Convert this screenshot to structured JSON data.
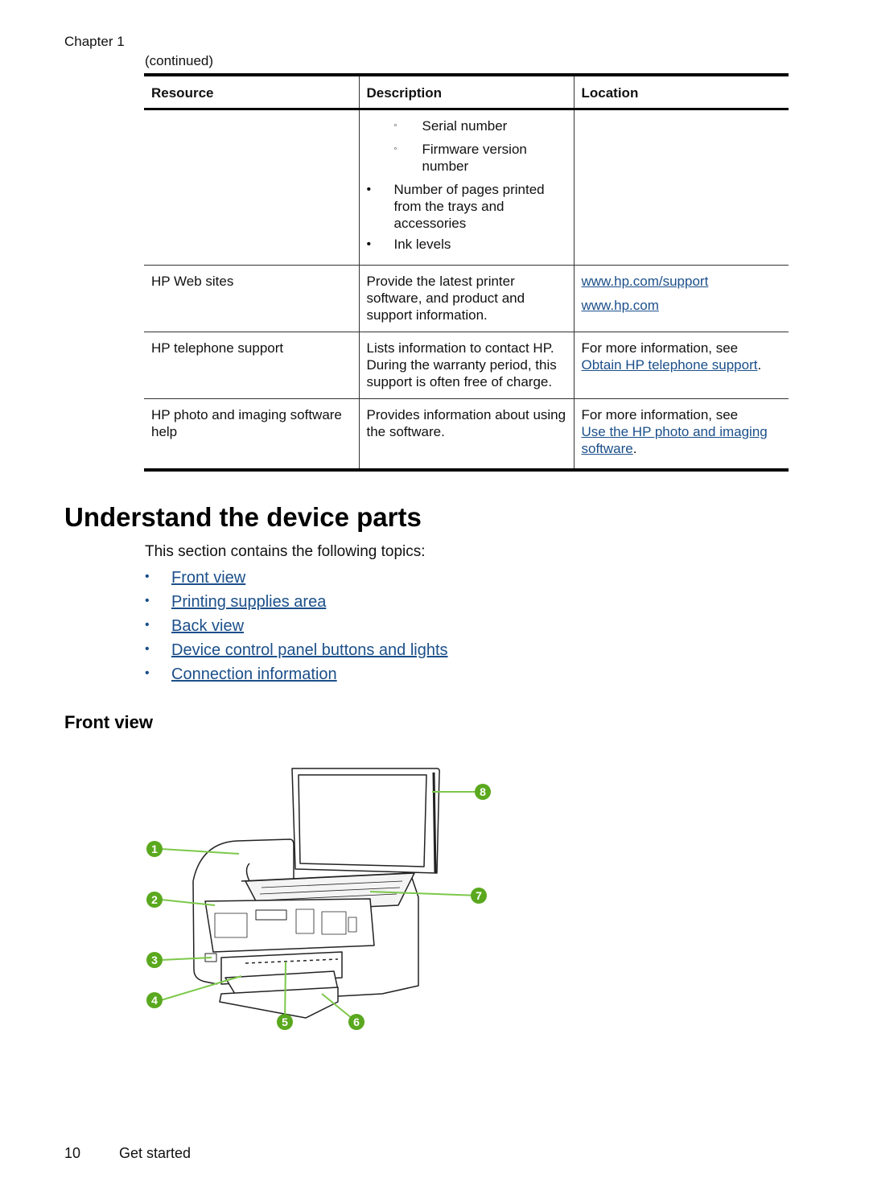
{
  "header": {
    "chapter": "Chapter 1",
    "continued": "(continued)"
  },
  "table": {
    "headers": [
      "Resource",
      "Description",
      "Location"
    ],
    "rows": [
      {
        "resource": "",
        "description_items": [
          {
            "level": 2,
            "bullet": "◦",
            "text": "Serial number"
          },
          {
            "level": 2,
            "bullet": "◦",
            "text": "Firmware version number"
          },
          {
            "level": 1,
            "bullet": "•",
            "text": "Number of pages printed from the trays and accessories"
          },
          {
            "level": 1,
            "bullet": "•",
            "text": "Ink levels"
          }
        ],
        "location": ""
      },
      {
        "resource": "HP Web sites",
        "description": "Provide the latest printer software, and product and support information.",
        "location_links": [
          "www.hp.com/support",
          "www.hp.com"
        ]
      },
      {
        "resource": "HP telephone support",
        "description": "Lists information to contact HP. During the warranty period, this support is often free of charge.",
        "location_prefix": "For more information, see",
        "location_link": "Obtain HP telephone support",
        "location_suffix": "."
      },
      {
        "resource": "HP photo and imaging software help",
        "description": "Provides information about using the software.",
        "location_prefix": "For more information, see",
        "location_link": "Use the HP photo and imaging software",
        "location_suffix": "."
      }
    ]
  },
  "section": {
    "title": "Understand the device parts",
    "intro": "This section contains the following topics:",
    "bullet": "•",
    "topics": [
      "Front view",
      "Printing supplies area",
      "Back view",
      "Device control panel buttons and lights",
      "Connection information"
    ]
  },
  "subsection": {
    "title": "Front view"
  },
  "figure": {
    "callouts": [
      "1",
      "2",
      "3",
      "4",
      "5",
      "6",
      "7",
      "8"
    ],
    "callout_color": "#5aa81e",
    "line_color": "#7cc84a"
  },
  "colors": {
    "link": "#1b4f8a",
    "text": "#111111"
  },
  "footer": {
    "page_number": "10",
    "section": "Get started"
  }
}
